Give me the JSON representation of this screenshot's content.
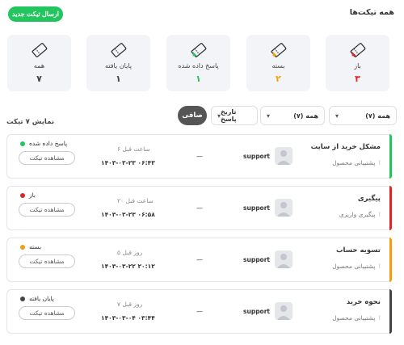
{
  "header": {
    "title": "همه تیکت‌ها",
    "new_ticket_label": "ارسال تیکت جدید"
  },
  "colors": {
    "accent": "#22c55e",
    "open": "#dc2626",
    "closed": "#f59e0b",
    "answered": "#22c55e",
    "finished": "#444444",
    "all": "#444444"
  },
  "stats": [
    {
      "label": "باز",
      "count": "۳",
      "color": "#dc2626",
      "icon": "ticket-icon"
    },
    {
      "label": "بسته",
      "count": "۲",
      "color": "#f59e0b",
      "icon": "ticket-icon"
    },
    {
      "label": "پاسخ داده شده",
      "count": "۱",
      "color": "#22c55e",
      "icon": "ticket-icon"
    },
    {
      "label": "پایان یافته",
      "count": "۱",
      "color": "#444444",
      "icon": "ticket-icon"
    },
    {
      "label": "همه",
      "count": "۷",
      "color": "#444444",
      "icon": "ticket-icon"
    }
  ],
  "filters": {
    "filter1": "همه (۷)",
    "filter2": "همه (۷)",
    "sort": "تاریخ پاسخ",
    "clear_label": "صافی",
    "count_text": "نمایش ۷ تیکت"
  },
  "tickets": [
    {
      "title": "مشکل خرید از سایت",
      "department": "پشتیبانی محصول",
      "user": "support",
      "priority": "—",
      "ago": "۶ ساعت قبل",
      "date": "۱۴۰۳-۰۳-۲۳ ۰۶:۴۳",
      "status": "پاسخ داده شده",
      "status_color": "#22c55e",
      "view_label": "مشاهده تیکت"
    },
    {
      "title": "پیگیری",
      "department": "پیگیری واریزی",
      "user": "support",
      "priority": "—",
      "ago": "۲۰ ساعت قبل",
      "date": "۱۴۰۳-۰۳-۲۳ ۰۶:۵۸",
      "status": "باز",
      "status_color": "#dc2626",
      "view_label": "مشاهده تیکت"
    },
    {
      "title": "تسویه حساب",
      "department": "پشتیبانی محصول",
      "user": "support",
      "priority": "—",
      "ago": "۵ روز قبل",
      "date": "۱۴۰۳-۰۳-۲۲ ۲۰:۱۲",
      "status": "بسته",
      "status_color": "#f59e0b",
      "view_label": "مشاهده تیکت"
    },
    {
      "title": "نحوه خرید",
      "department": "پشتیبانی محصول",
      "user": "support",
      "priority": "—",
      "ago": "۷ روز قبل",
      "date": "۱۴۰۳-۰۳-۰۴ ۰۳:۴۴",
      "status": "پایان یافته",
      "status_color": "#444444",
      "view_label": "مشاهده تیکت"
    }
  ]
}
